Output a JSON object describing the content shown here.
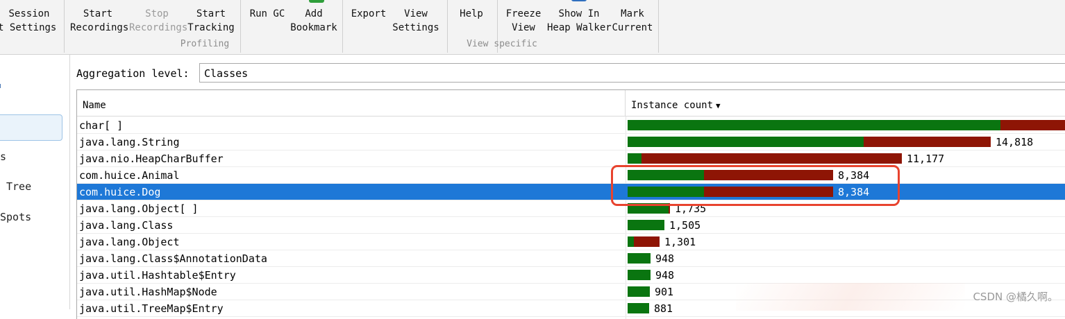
{
  "toolbar": {
    "buttons": [
      {
        "l1": "Session",
        "l2": "ot Settings",
        "enabled": true
      },
      {
        "l1": "Start",
        "l2": "Recordings",
        "enabled": true
      },
      {
        "l1": "Stop",
        "l2": "Recordings",
        "enabled": false
      },
      {
        "l1": "Start",
        "l2": "Tracking",
        "enabled": true
      },
      {
        "l1": "Run GC",
        "l2": "",
        "enabled": true
      },
      {
        "l1": "Add",
        "l2": "Bookmark",
        "enabled": true
      },
      {
        "l1": "Export",
        "l2": "",
        "enabled": true
      },
      {
        "l1": "View",
        "l2": "Settings",
        "enabled": true
      },
      {
        "l1": "Help",
        "l2": "",
        "enabled": true
      },
      {
        "l1": "Freeze",
        "l2": "View",
        "enabled": true
      },
      {
        "l1": "Show In",
        "l2": "Heap Walker",
        "enabled": true
      },
      {
        "l1": "Mark",
        "l2": "Current",
        "enabled": true
      }
    ],
    "groups": {
      "profiling": "Profiling",
      "view_specific": "View specific"
    }
  },
  "sidebar": {
    "items": [
      {
        "label": "s"
      },
      {
        "label": "Tree"
      },
      {
        "label": "Spots"
      }
    ]
  },
  "aggregation": {
    "label": "Aggregation level:",
    "value": "Classes"
  },
  "table": {
    "columns": {
      "name": "Name",
      "count": "Instance count"
    },
    "rows": [
      {
        "name": "char[ ]",
        "count": "",
        "value": 20000,
        "retained": 0.76
      },
      {
        "name": "java.lang.String",
        "count": "14,818",
        "value": 14818,
        "retained": 0.65
      },
      {
        "name": "java.nio.HeapCharBuffer",
        "count": "11,177",
        "value": 11177,
        "retained": 0.05
      },
      {
        "name": "com.huice.Animal",
        "count": "8,384",
        "value": 8384,
        "retained": 0.37
      },
      {
        "name": "com.huice.Dog",
        "count": "8,384",
        "value": 8384,
        "retained": 0.37
      },
      {
        "name": "java.lang.Object[ ]",
        "count": "1,735",
        "value": 1735,
        "retained": 0.97
      },
      {
        "name": "java.lang.Class",
        "count": "1,505",
        "value": 1505,
        "retained": 1.0
      },
      {
        "name": "java.lang.Object",
        "count": "1,301",
        "value": 1301,
        "retained": 0.2
      },
      {
        "name": "java.lang.Class$AnnotationData",
        "count": "948",
        "value": 948,
        "retained": 1.0
      },
      {
        "name": "java.util.Hashtable$Entry",
        "count": "948",
        "value": 948,
        "retained": 1.0
      },
      {
        "name": "java.util.HashMap$Node",
        "count": "901",
        "value": 901,
        "retained": 1.0
      },
      {
        "name": "java.util.TreeMap$Entry",
        "count": "881",
        "value": 881,
        "retained": 1.0
      }
    ],
    "selected_index": 4
  },
  "colors": {
    "bar_green": "#0a7510",
    "bar_red": "#8e1505",
    "selection": "#1e78d7",
    "annotation": "#e8432e"
  },
  "watermark": "CSDN @橘久啊。"
}
